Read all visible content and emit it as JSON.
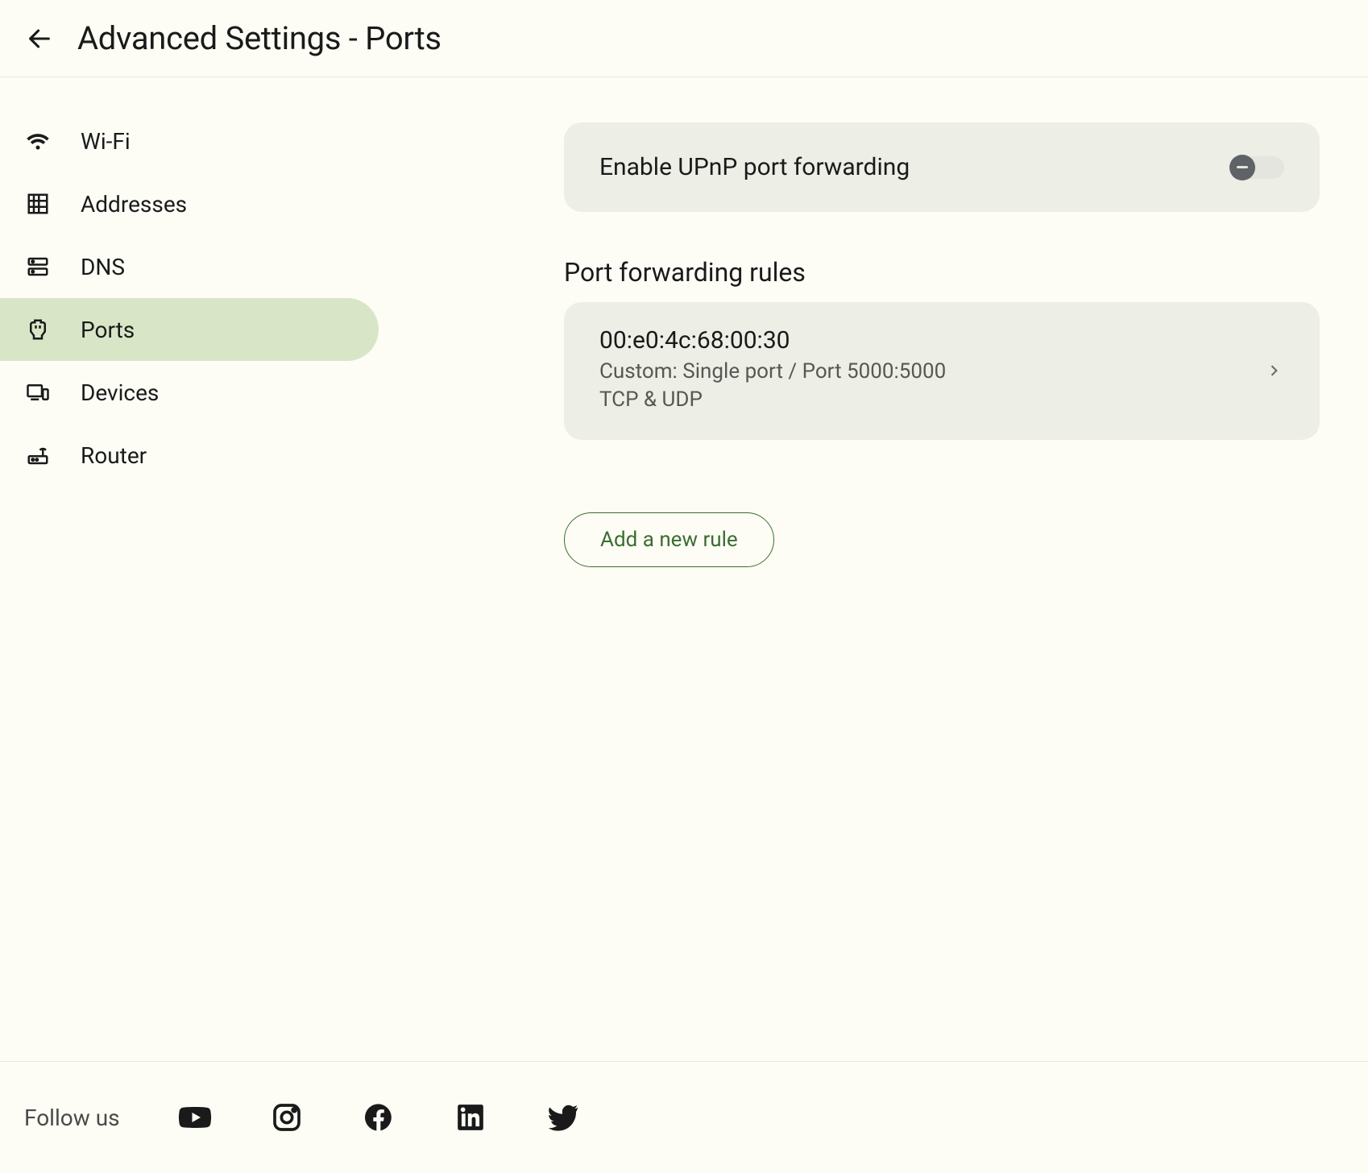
{
  "header": {
    "title": "Advanced Settings - Ports"
  },
  "sidebar": {
    "items": [
      {
        "label": "Wi-Fi"
      },
      {
        "label": "Addresses"
      },
      {
        "label": "DNS"
      },
      {
        "label": "Ports"
      },
      {
        "label": "Devices"
      },
      {
        "label": "Router"
      }
    ]
  },
  "upnp": {
    "label": "Enable UPnP port forwarding",
    "enabled": false
  },
  "rulesHeading": "Port forwarding rules",
  "rules": [
    {
      "title": "00:e0:4c:68:00:30",
      "line1": "Custom: Single port / Port 5000:5000",
      "line2": "TCP & UDP"
    }
  ],
  "addRuleLabel": "Add a new rule",
  "footer": {
    "followLabel": "Follow us"
  }
}
